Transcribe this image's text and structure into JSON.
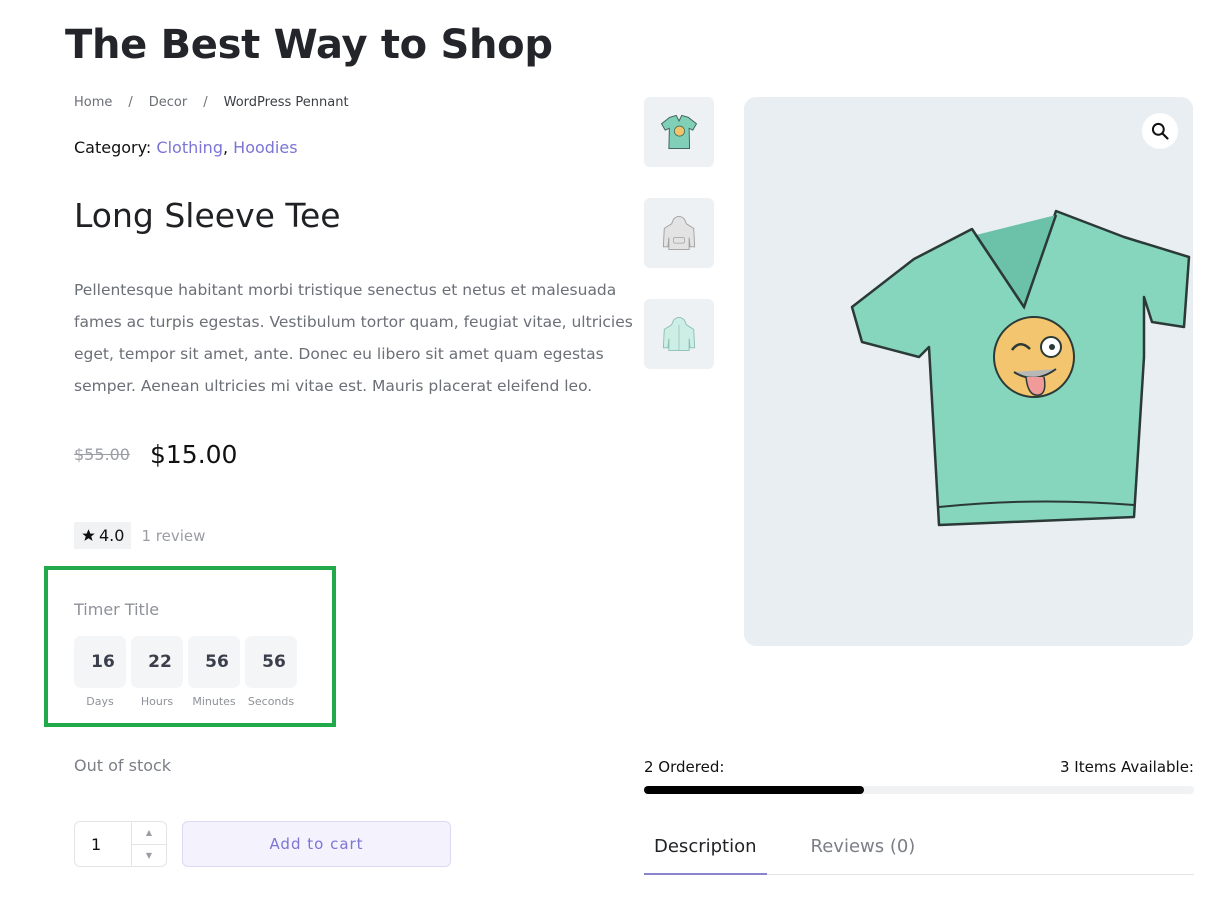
{
  "site": {
    "title": "The Best Way to Shop"
  },
  "breadcrumb": [
    {
      "label": "Home"
    },
    {
      "label": "Decor"
    },
    {
      "label": "WordPress Pennant"
    }
  ],
  "breadcrumb_separator": "/",
  "category": {
    "label": "Category:",
    "links": [
      "Clothing",
      "Hoodies"
    ],
    "separator": ","
  },
  "product": {
    "title": "Long Sleeve Tee",
    "description": "Pellentesque habitant morbi tristique senectus et netus et malesuada fames ac turpis egestas. Vestibulum tortor quam, feugiat vitae, ultricies eget, tempor sit amet, ante. Donec eu libero sit amet quam egestas semper. Aenean ultricies mi vitae est. Mauris placerat eleifend leo.",
    "price_old": "$55.00",
    "price_new": "$15.00",
    "rating": "4.0",
    "rating_icon": "star-icon",
    "review_count": "1 review",
    "stock_status": "Out of stock"
  },
  "timer": {
    "title": "Timer Title",
    "units": [
      {
        "value": "16",
        "label": "Days"
      },
      {
        "value": "22",
        "label": "Hours"
      },
      {
        "value": "56",
        "label": "Minutes"
      },
      {
        "value": "56",
        "label": "Seconds"
      }
    ]
  },
  "cart": {
    "quantity": "1",
    "add_label": "Add to cart",
    "increment_icon": "caret-up-icon",
    "decrement_icon": "caret-down-icon"
  },
  "gallery": {
    "thumbnails": [
      {
        "name": "tshirt-thumbnail"
      },
      {
        "name": "hoodie-gray-thumbnail"
      },
      {
        "name": "hoodie-zip-thumbnail"
      }
    ],
    "zoom_icon": "magnifier-icon"
  },
  "stock_progress": {
    "ordered_label": "2 Ordered:",
    "available_label": "3 Items Available:",
    "ordered": 2,
    "available": 3,
    "fraction": 0.4
  },
  "tabs": [
    {
      "label": "Description",
      "active": true
    },
    {
      "label": "Reviews (0)",
      "active": false
    }
  ],
  "colors": {
    "accent": "#7b75d6",
    "highlight_border": "#22a94a",
    "progress_fill": "#000000"
  }
}
